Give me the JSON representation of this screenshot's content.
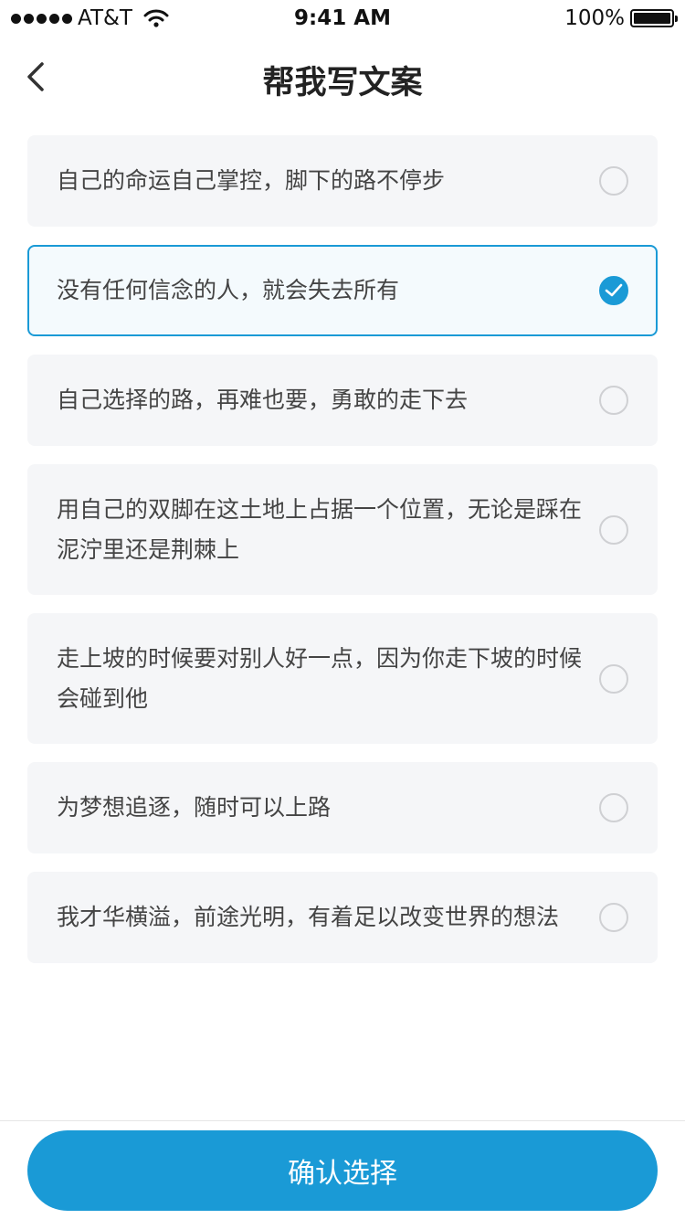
{
  "status_bar": {
    "carrier": "AT&T",
    "time": "9:41 AM",
    "battery": "100%"
  },
  "nav": {
    "title": "帮我写文案",
    "back_icon": "chevron-left-icon"
  },
  "options": [
    {
      "text": "自己的命运自己掌控，脚下的路不停步",
      "selected": false
    },
    {
      "text": "没有任何信念的人，就会失去所有",
      "selected": true
    },
    {
      "text": "自己选择的路，再难也要，勇敢的走下去",
      "selected": false
    },
    {
      "text": "用自己的双脚在这土地上占据一个位置，无论是踩在泥泞里还是荆棘上",
      "selected": false
    },
    {
      "text": "走上坡的时候要对别人好一点，因为你走下坡的时候会碰到他",
      "selected": false
    },
    {
      "text": "为梦想追逐，随时可以上路",
      "selected": false
    },
    {
      "text": "我才华横溢，前途光明，有着足以改变世界的想法",
      "selected": false
    }
  ],
  "footer": {
    "confirm_label": "确认选择"
  },
  "colors": {
    "accent": "#1a9ad6",
    "card_bg": "#f5f6f8",
    "selected_bg": "#f4fafd"
  }
}
